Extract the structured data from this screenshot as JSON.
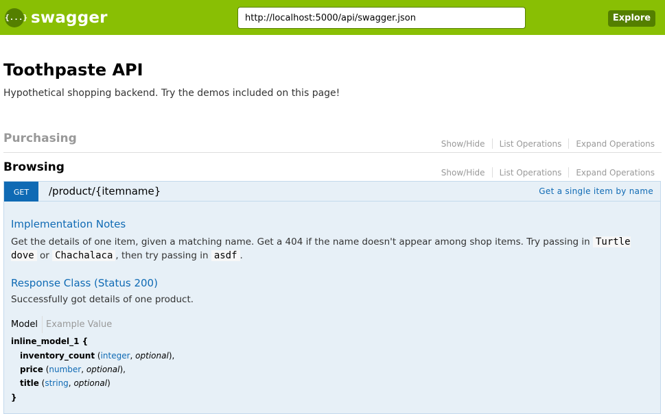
{
  "header": {
    "logo_icon": "{...}",
    "logo_text": "swagger",
    "url_value": "http://localhost:5000/api/swagger.json",
    "explore_label": "Explore"
  },
  "info": {
    "title": "Toothpaste API",
    "description": "Hypothetical shopping backend. Try the demos included on this page!"
  },
  "sections": [
    {
      "name": "Purchasing",
      "show_hide": "Show/Hide",
      "list_ops": "List Operations",
      "expand_ops": "Expand Operations"
    },
    {
      "name": "Browsing",
      "show_hide": "Show/Hide",
      "list_ops": "List Operations",
      "expand_ops": "Expand Operations"
    }
  ],
  "operation": {
    "method": "GET",
    "path": "/product/{itemname}",
    "summary": "Get a single item by name",
    "impl_heading": "Implementation Notes",
    "impl_text_1": "Get the details of one item, given a matching name. Get a 404 if the name doesn't appear among shop items. Try passing in",
    "impl_code_1": "Turtle dove",
    "impl_or": "or",
    "impl_code_2": "Chachalaca",
    "impl_text_2": ", then try passing in",
    "impl_code_3": "asdf",
    "impl_text_3": ".",
    "response_heading": "Response Class (Status 200)",
    "response_text": "Successfully got details of one product.",
    "tab_model": "Model",
    "tab_example": "Example Value",
    "model_name": "inline_model_1 {",
    "model_close": "}",
    "props": [
      {
        "name": "inventory_count",
        "type": "integer",
        "optional": "optional",
        "end": "),"
      },
      {
        "name": "price",
        "type": "number",
        "optional": "optional",
        "end": "),"
      },
      {
        "name": "title",
        "type": "string",
        "optional": "optional",
        "end": ")"
      }
    ]
  },
  "colors": {
    "header_bg": "#89bf04",
    "accent": "#547f00",
    "get_blue": "#0f6ab4",
    "op_bg": "#e7f0f7"
  }
}
